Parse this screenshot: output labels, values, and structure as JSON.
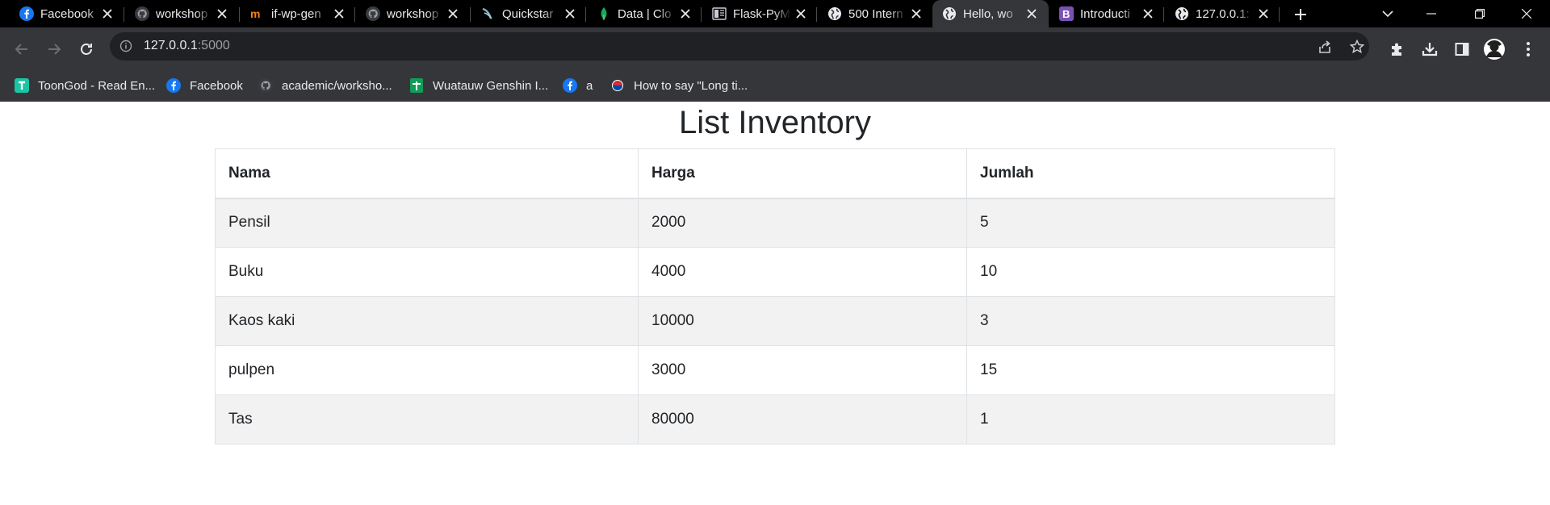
{
  "browser": {
    "tabs": [
      {
        "title": "Facebook",
        "favicon": "facebook-icon"
      },
      {
        "title": "workshop",
        "favicon": "github-icon"
      },
      {
        "title": "if-wp-gen",
        "favicon": "moodle-icon"
      },
      {
        "title": "workshop",
        "favicon": "github-icon"
      },
      {
        "title": "Quickstar",
        "favicon": "flask-icon"
      },
      {
        "title": "Data | Clo",
        "favicon": "mongodb-icon"
      },
      {
        "title": "Flask-PyM",
        "favicon": "docs-icon"
      },
      {
        "title": "500 Intern",
        "favicon": "globe-icon"
      },
      {
        "title": "Hello, wo",
        "favicon": "globe-icon",
        "active": true
      },
      {
        "title": "Introducti",
        "favicon": "bootstrap-icon"
      },
      {
        "title": "127.0.0.1:",
        "favicon": "globe-icon"
      }
    ],
    "address": {
      "host": "127.0.0.1",
      "port": ":5000"
    },
    "bookmarks": [
      {
        "label": "ToonGod - Read En...",
        "favicon": "toongod-icon"
      },
      {
        "label": "Facebook",
        "favicon": "facebook-icon"
      },
      {
        "label": "academic/worksho...",
        "favicon": "github-icon"
      },
      {
        "label": "Wuatauw Genshin I...",
        "favicon": "sheets-icon"
      },
      {
        "label": "a",
        "favicon": "facebook-icon"
      },
      {
        "label": "How to say \"Long ti...",
        "favicon": "korea-flag-icon"
      }
    ],
    "colors": {
      "tabstrip": "#000000",
      "toolbar": "#35363a",
      "omnibox": "#202124",
      "text": "#e8eaed"
    }
  },
  "page": {
    "title": "List Inventory",
    "table": {
      "headers": [
        "Nama",
        "Harga",
        "Jumlah"
      ],
      "rows": [
        [
          "Pensil",
          "2000",
          "5"
        ],
        [
          "Buku",
          "4000",
          "10"
        ],
        [
          "Kaos kaki",
          "10000",
          "3"
        ],
        [
          "pulpen",
          "3000",
          "15"
        ],
        [
          "Tas",
          "80000",
          "1"
        ]
      ]
    },
    "colors": {
      "text": "#212529",
      "stripe": "#f2f2f2",
      "border": "#dee2e6"
    }
  }
}
